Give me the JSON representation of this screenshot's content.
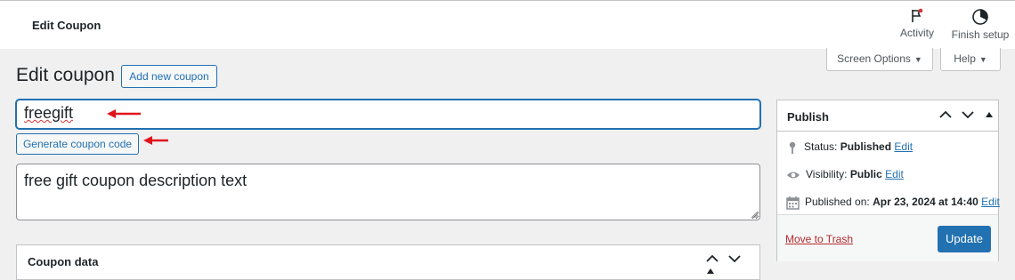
{
  "topbar": {
    "title": "Edit Coupon",
    "activity_label": "Activity",
    "finish_setup_label": "Finish setup"
  },
  "screen_options": {
    "label": "Screen Options"
  },
  "help": {
    "label": "Help"
  },
  "page": {
    "title": "Edit coupon",
    "add_new_label": "Add new coupon"
  },
  "coupon": {
    "code": "freegift",
    "generate_label": "Generate coupon code",
    "description": "free gift coupon description text"
  },
  "coupon_data": {
    "title": "Coupon data"
  },
  "publish": {
    "title": "Publish",
    "status_label": "Status:",
    "status_value": "Published",
    "visibility_label": "Visibility:",
    "visibility_value": "Public",
    "published_label": "Published on:",
    "published_value": "Apr 23, 2024 at 14:40",
    "edit_label": "Edit",
    "trash_label": "Move to Trash",
    "update_label": "Update"
  },
  "colors": {
    "accent": "#2271b1",
    "annotation_arrow": "#e0141b",
    "trash": "#b32d2e",
    "notification_dot": "#d63638"
  }
}
